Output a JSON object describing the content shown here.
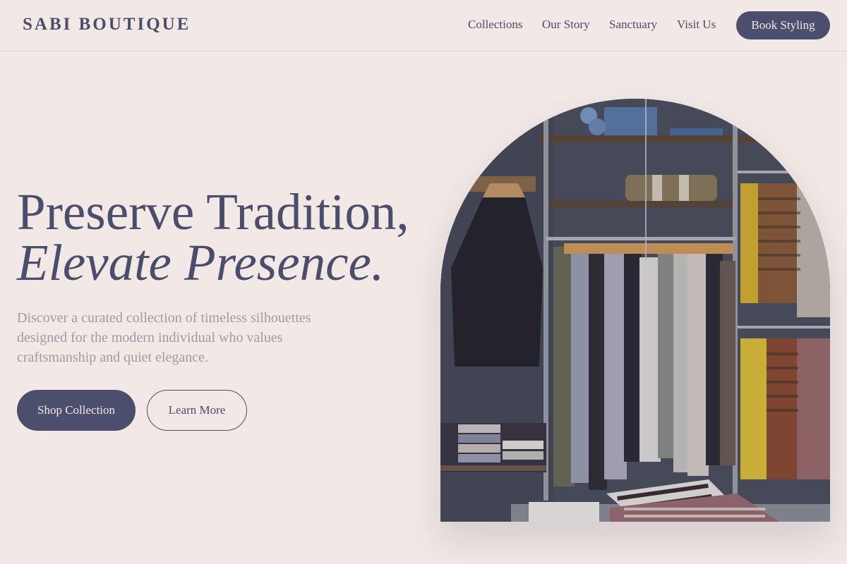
{
  "header": {
    "logo": "SABI BOUTIQUE",
    "nav": [
      "Collections",
      "Our Story",
      "Sanctuary",
      "Visit Us"
    ],
    "cta": "Book Styling"
  },
  "hero": {
    "title_line1": "Preserve Tradition,",
    "title_line2": "Elevate Presence.",
    "description": "Discover a curated collection of timeless silhouettes designed for the modern individual who values craftsmanship and quiet elegance.",
    "primary_button": "Shop Collection",
    "secondary_button": "Learn More"
  },
  "colors": {
    "background": "#f2e8e5",
    "primary": "#4b4e6d",
    "muted_text": "#a39aa1"
  }
}
